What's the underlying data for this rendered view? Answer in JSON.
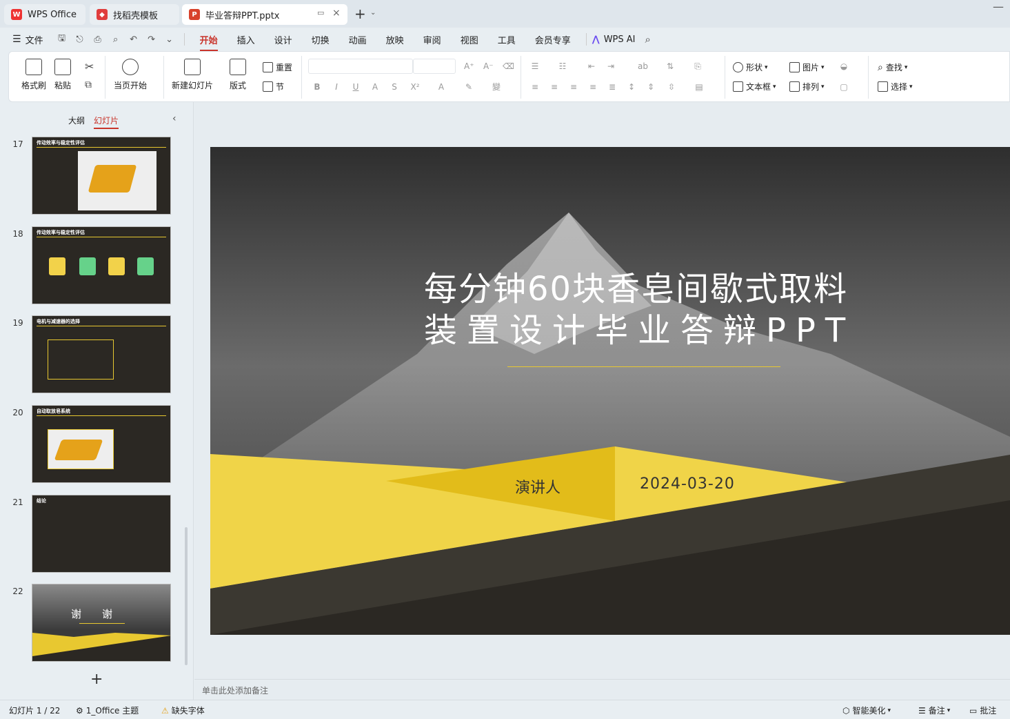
{
  "tabs": [
    {
      "label": "WPS Office",
      "icon": "wps-logo-icon"
    },
    {
      "label": "找稻壳模板",
      "icon": "docer-icon"
    },
    {
      "label": "毕业答辩PPT.pptx",
      "icon": "presentation-file-icon"
    }
  ],
  "menu": {
    "file": "文件",
    "items": [
      "开始",
      "插入",
      "设计",
      "切换",
      "动画",
      "放映",
      "审阅",
      "视图",
      "工具",
      "会员专享"
    ],
    "active": "开始",
    "wps_ai": "WPS AI"
  },
  "ribbon": {
    "format_painter": "格式刷",
    "paste": "粘贴",
    "from_current": "当页开始",
    "new_slide": "新建幻灯片",
    "layout": "版式",
    "reset": "重置",
    "section": "节",
    "shape": "形状",
    "picture": "图片",
    "textbox": "文本框",
    "arrange": "排列",
    "find": "查找",
    "select": "选择"
  },
  "panel": {
    "outline_tab": "大纲",
    "slides_tab": "幻灯片",
    "add": "+"
  },
  "thumbnails": [
    {
      "num": "17",
      "title": "传动效率与稳定性评估"
    },
    {
      "num": "18",
      "title": "传动效率与稳定性评估"
    },
    {
      "num": "19",
      "title": "电机与减速器的选择"
    },
    {
      "num": "20",
      "title": "自动取放皂系统"
    },
    {
      "num": "21",
      "title": "结论"
    },
    {
      "num": "22",
      "title": "谢　　谢"
    }
  ],
  "slide": {
    "title_line1": "每分钟60块香皂间歇式取料",
    "title_line2": "装置设计毕业答辩PPT",
    "presenter": "演讲人",
    "date": "2024-03-20"
  },
  "notes_placeholder": "单击此处添加备注",
  "status": {
    "slide_count": "幻灯片 1 / 22",
    "theme": "1_Office 主题",
    "missing_font": "缺失字体",
    "beautify": "智能美化",
    "notes": "备注",
    "comments": "批注"
  },
  "colors": {
    "accent": "#c9342b",
    "slide_yellow": "#f0d448",
    "slide_dark": "#2b2823"
  }
}
